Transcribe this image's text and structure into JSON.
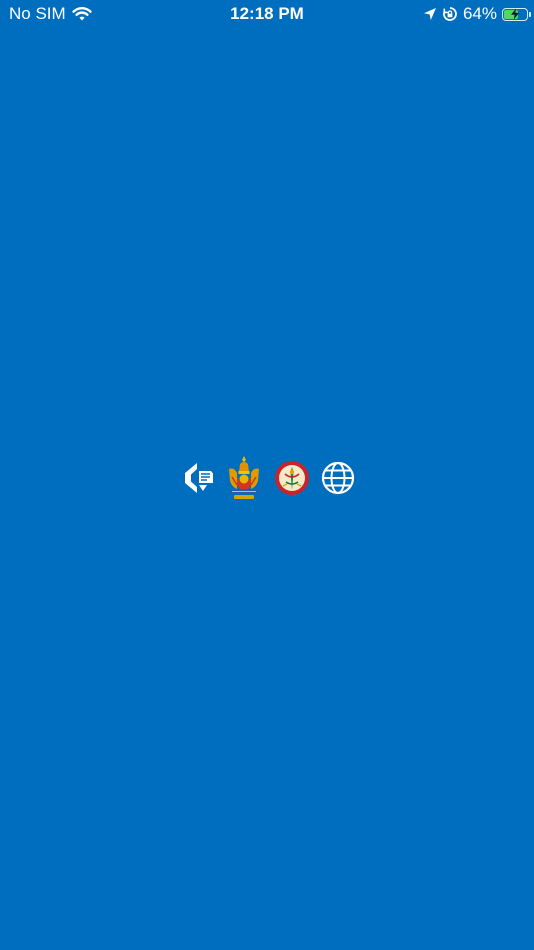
{
  "status_bar": {
    "carrier": "No SIM",
    "time": "12:18 PM",
    "battery_percent_label": "64%",
    "battery_level": 0.64,
    "charging": true,
    "icons": [
      "wifi-icon",
      "location-arrow-icon",
      "orientation-lock-icon",
      "battery-icon"
    ]
  },
  "splash": {
    "background_color": "#006EBE",
    "logos": [
      "app-logo-icon",
      "royal-crest-icon",
      "ministry-seal-icon",
      "globe-icon"
    ]
  }
}
